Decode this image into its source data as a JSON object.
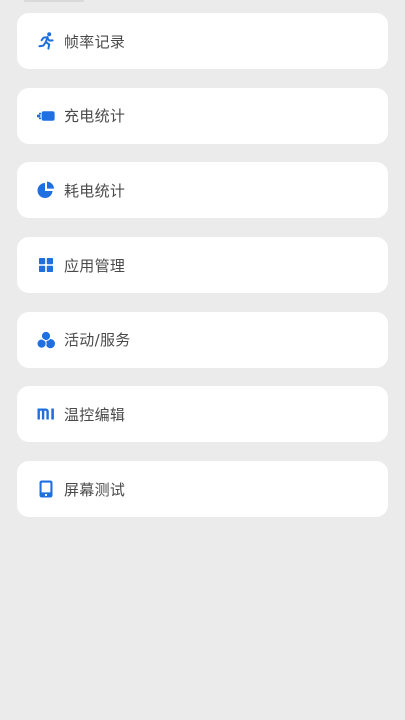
{
  "accent_color": "#1f6fe0",
  "menu": {
    "items": [
      {
        "id": "frame-rate-record",
        "label": "帧率记录",
        "icon": "running-figure-icon"
      },
      {
        "id": "charging-stats",
        "label": "充电统计",
        "icon": "charging-battery-icon"
      },
      {
        "id": "power-usage-stats",
        "label": "耗电统计",
        "icon": "pie-chart-icon"
      },
      {
        "id": "app-management",
        "label": "应用管理",
        "icon": "grid-four-squares-icon"
      },
      {
        "id": "activities-services",
        "label": "活动/服务",
        "icon": "three-circles-icon"
      },
      {
        "id": "thermal-control-edit",
        "label": "温控编辑",
        "icon": "mi-logo-icon"
      },
      {
        "id": "screen-test",
        "label": "屏幕测试",
        "icon": "phone-screen-icon"
      }
    ]
  }
}
